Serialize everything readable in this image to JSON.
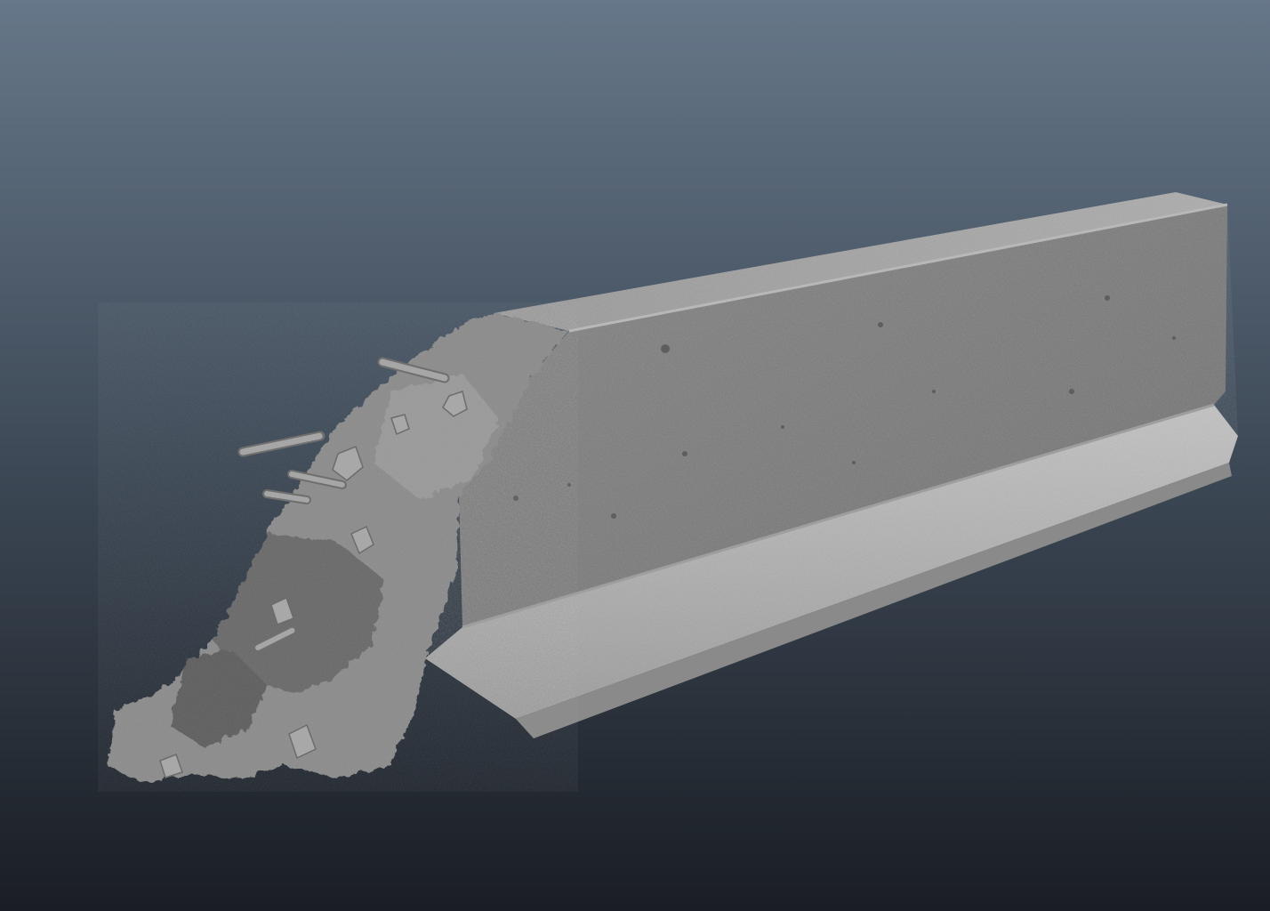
{
  "viewport": {
    "background_top": "#667789",
    "background_mid": "#3a4552",
    "background_bottom": "#1a1e24"
  },
  "model": {
    "material_colors": {
      "top_face": "#a4a4a4",
      "front_face": "#7f7f7f",
      "front_face_shadow": "#727272",
      "lower_curb": "#b1b1b1",
      "lower_curb_highlight": "#c4c4c4",
      "broken_concrete": "#8c8c8c",
      "broken_concrete_dark": "#5e5e5e",
      "rebar": "#9a9a9a"
    },
    "rebar_count": 5
  }
}
